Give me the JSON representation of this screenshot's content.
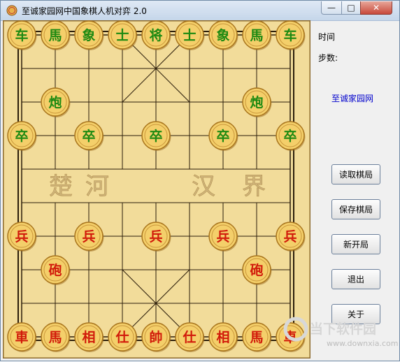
{
  "window": {
    "title": "至诚家园网中国象棋人机对弈 2.0"
  },
  "titlebar_buttons": {
    "minimize": "—",
    "maximize": "□",
    "close": "✕"
  },
  "board": {
    "river": [
      "楚",
      "河",
      "汉",
      "界"
    ],
    "black_pieces": [
      {
        "t": "车",
        "c": 0,
        "r": 0
      },
      {
        "t": "馬",
        "c": 1,
        "r": 0
      },
      {
        "t": "象",
        "c": 2,
        "r": 0
      },
      {
        "t": "士",
        "c": 3,
        "r": 0
      },
      {
        "t": "将",
        "c": 4,
        "r": 0
      },
      {
        "t": "士",
        "c": 5,
        "r": 0
      },
      {
        "t": "象",
        "c": 6,
        "r": 0
      },
      {
        "t": "馬",
        "c": 7,
        "r": 0
      },
      {
        "t": "车",
        "c": 8,
        "r": 0
      },
      {
        "t": "炮",
        "c": 1,
        "r": 2
      },
      {
        "t": "炮",
        "c": 7,
        "r": 2
      },
      {
        "t": "卒",
        "c": 0,
        "r": 3
      },
      {
        "t": "卒",
        "c": 2,
        "r": 3
      },
      {
        "t": "卒",
        "c": 4,
        "r": 3
      },
      {
        "t": "卒",
        "c": 6,
        "r": 3
      },
      {
        "t": "卒",
        "c": 8,
        "r": 3
      }
    ],
    "red_pieces": [
      {
        "t": "兵",
        "c": 0,
        "r": 6
      },
      {
        "t": "兵",
        "c": 2,
        "r": 6
      },
      {
        "t": "兵",
        "c": 4,
        "r": 6
      },
      {
        "t": "兵",
        "c": 6,
        "r": 6
      },
      {
        "t": "兵",
        "c": 8,
        "r": 6
      },
      {
        "t": "砲",
        "c": 1,
        "r": 7
      },
      {
        "t": "砲",
        "c": 7,
        "r": 7
      },
      {
        "t": "車",
        "c": 0,
        "r": 9
      },
      {
        "t": "馬",
        "c": 1,
        "r": 9
      },
      {
        "t": "相",
        "c": 2,
        "r": 9
      },
      {
        "t": "仕",
        "c": 3,
        "r": 9
      },
      {
        "t": "帥",
        "c": 4,
        "r": 9
      },
      {
        "t": "仕",
        "c": 5,
        "r": 9
      },
      {
        "t": "相",
        "c": 6,
        "r": 9
      },
      {
        "t": "馬",
        "c": 7,
        "r": 9
      },
      {
        "t": "車",
        "c": 8,
        "r": 9
      }
    ],
    "colors": {
      "black_text": "#1e8a12",
      "red_text": "#d11a0a",
      "wood": "#f2dc9a",
      "piece": "#f4cf6a"
    }
  },
  "sidebar": {
    "time_label": "时间",
    "steps_label": "步数:",
    "site_link": "至诚家园网",
    "buttons": {
      "load": "读取棋局",
      "save": "保存棋局",
      "new": "新开局",
      "exit": "退出",
      "about": "关于"
    }
  },
  "watermark": {
    "brand": "当下软件园",
    "url": "www.downxia.com"
  }
}
